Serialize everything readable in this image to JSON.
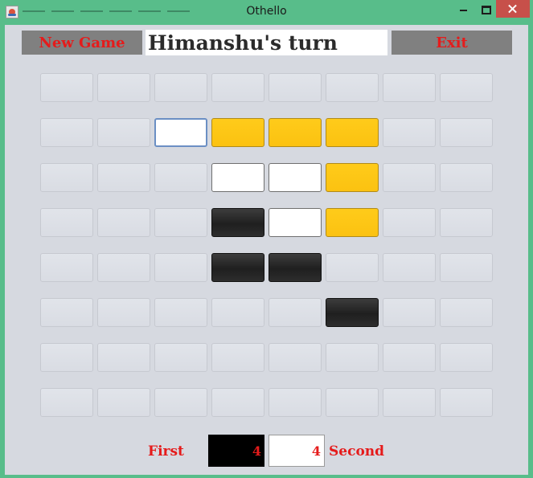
{
  "window": {
    "title": "Othello"
  },
  "toolbar": {
    "new_game_label": "New Game",
    "exit_label": "Exit"
  },
  "status": {
    "text": "Himanshu's turn"
  },
  "board": {
    "rows": 8,
    "cols": 8,
    "cells": [
      [
        "empty",
        "empty",
        "empty",
        "empty",
        "empty",
        "empty",
        "empty",
        "empty"
      ],
      [
        "empty",
        "empty",
        "white",
        "yellow",
        "yellow",
        "yellow",
        "empty",
        "empty"
      ],
      [
        "empty",
        "empty",
        "empty",
        "white",
        "white",
        "yellow",
        "empty",
        "empty"
      ],
      [
        "empty",
        "empty",
        "empty",
        "black",
        "white",
        "yellow",
        "empty",
        "empty"
      ],
      [
        "empty",
        "empty",
        "empty",
        "black",
        "black",
        "empty",
        "empty",
        "empty"
      ],
      [
        "empty",
        "empty",
        "empty",
        "empty",
        "empty",
        "black",
        "empty",
        "empty"
      ],
      [
        "empty",
        "empty",
        "empty",
        "empty",
        "empty",
        "empty",
        "empty",
        "empty"
      ],
      [
        "empty",
        "empty",
        "empty",
        "empty",
        "empty",
        "empty",
        "empty",
        "empty"
      ]
    ],
    "focused_cell": [
      1,
      2
    ]
  },
  "score": {
    "first_label": "First",
    "first_value": "4",
    "second_label": "Second",
    "second_value": "4"
  },
  "colors": {
    "accent_text": "#e51b1b",
    "button_bg": "#808080",
    "highlight": "#ffcb1a",
    "window_frame": "#58bd8a",
    "panel_bg": "#d6d9e0"
  }
}
